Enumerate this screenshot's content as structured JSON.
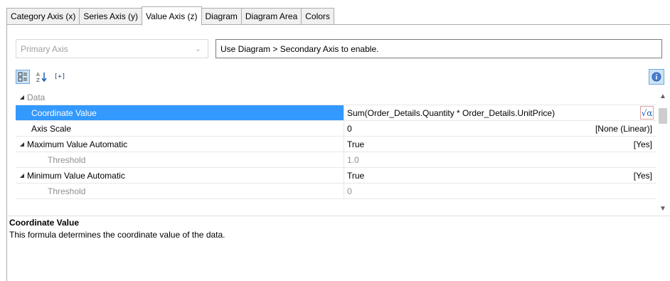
{
  "tabs": [
    {
      "label": "Category Axis (x)",
      "active": false
    },
    {
      "label": "Series Axis (y)",
      "active": false
    },
    {
      "label": "Value Axis (z)",
      "active": true
    },
    {
      "label": "Diagram",
      "active": false
    },
    {
      "label": "Diagram Area",
      "active": false
    },
    {
      "label": "Colors",
      "active": false
    }
  ],
  "axis_select": {
    "value": "Primary Axis"
  },
  "hint": {
    "text": "Use Diagram > Secondary Axis to enable."
  },
  "toolbar": {
    "categorized_icon": "categorized-icon",
    "alphabetical_icon": "sort-alphabetical-icon",
    "expand_icon": "expand-all-icon",
    "expand_label": "[+]",
    "info_icon": "info-icon"
  },
  "grid": {
    "rows": [
      {
        "name": "Data",
        "value": "",
        "right": "",
        "kind": "category"
      },
      {
        "name": "Coordinate Value",
        "value": "Sum(Order_Details.Quantity * Order_Details.UnitPrice)",
        "right": "",
        "kind": "selected"
      },
      {
        "name": "Axis Scale",
        "value": "0",
        "right": "[None (Linear)]",
        "kind": "normal"
      },
      {
        "name": "Maximum Value Automatic",
        "value": "True",
        "right": "[Yes]",
        "kind": "group"
      },
      {
        "name": "Threshold",
        "value": "1.0",
        "right": "",
        "kind": "disabled"
      },
      {
        "name": "Minimum Value Automatic",
        "value": "True",
        "right": "[Yes]",
        "kind": "group"
      },
      {
        "name": "Threshold",
        "value": "0",
        "right": "",
        "kind": "disabled"
      }
    ]
  },
  "description": {
    "title": "Coordinate Value",
    "text": "This formula determines the coordinate value of the data."
  },
  "colors": {
    "selection": "#3399ff",
    "accent": "#1a5fb4"
  }
}
